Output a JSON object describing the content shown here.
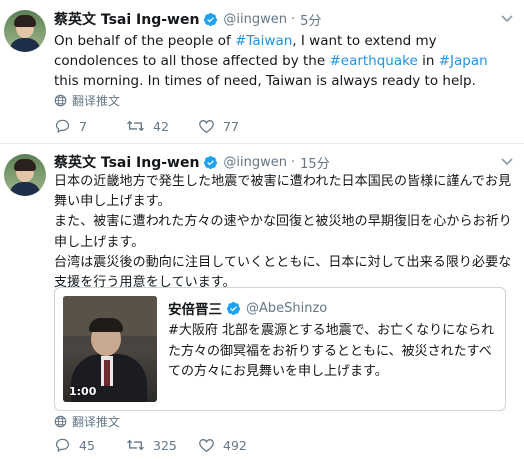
{
  "tweets": [
    {
      "name": "蔡英文 Tsai Ing-wen",
      "handle": "@iingwen",
      "separator": "·",
      "time": "5分",
      "text_parts": {
        "p1": "On behalf of the people of ",
        "t1": "#Taiwan",
        "p2": ", I want to extend my condolences to all those affected by the ",
        "t2": "#earthquake",
        "p3": " in ",
        "t3": "#Japan",
        "p4": " this morning. In times of need, Taiwan is always ready to help."
      },
      "translate_label": "翻译推文",
      "replies": "7",
      "retweets": "42",
      "likes": "77"
    },
    {
      "name": "蔡英文 Tsai Ing-wen",
      "handle": "@iingwen",
      "separator": "·",
      "time": "15分",
      "paragraphs": [
        "日本の近畿地方で発生した地震で被害に遭われた日本国民の皆様に謹んでお見舞い申し上げます。",
        "また、被害に遭われた方々の速やかな回復と被災地の早期復旧を心からお祈り申し上げます。",
        "台湾は震災後の動向に注目していくとともに、日本に対して出来る限り必要な支援を行う用意をしています。"
      ],
      "quote": {
        "name": "安倍晋三",
        "handle": "@AbeShinzo",
        "text": "#大阪府 北部を震源とする地震で、お亡くなりになられた方々の御冥福をお祈りするとともに、被災されたすべての方々にお見舞いを申し上げます。",
        "video_duration": "1:00"
      },
      "translate_label": "翻译推文",
      "replies": "45",
      "retweets": "325",
      "likes": "492"
    }
  ],
  "colors": {
    "link": "#1b95e0",
    "secondary_text": "#657786",
    "verified": "#1da1f2",
    "border": "#e6ecf0"
  },
  "icons": [
    "verified-badge-icon",
    "chevron-down-icon",
    "globe-icon",
    "reply-icon",
    "retweet-icon",
    "like-icon"
  ]
}
